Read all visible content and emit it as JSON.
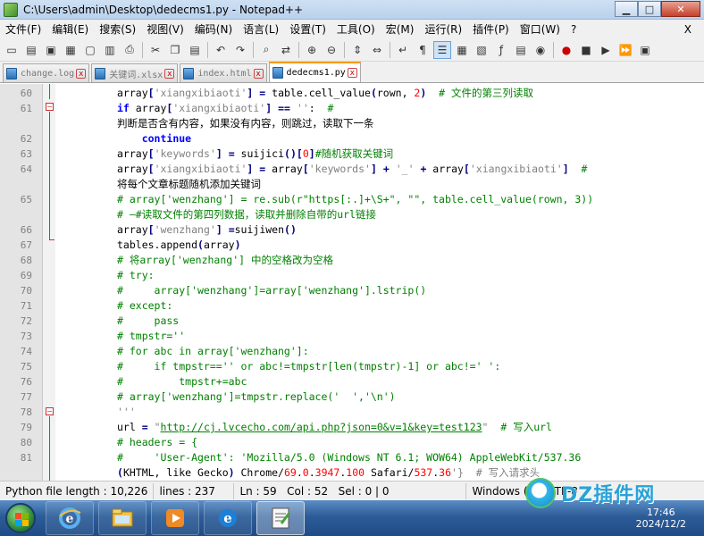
{
  "window": {
    "title": "C:\\Users\\admin\\Desktop\\dedecms1.py - Notepad++",
    "minimize_label": "▁",
    "maximize_label": "□",
    "close_label": "✕"
  },
  "menu": [
    "文件(F)",
    "编辑(E)",
    "搜索(S)",
    "视图(V)",
    "编码(N)",
    "语言(L)",
    "设置(T)",
    "工具(O)",
    "宏(M)",
    "运行(R)",
    "插件(P)",
    "窗口(W)",
    "?"
  ],
  "menu_close": "X",
  "tabs": [
    {
      "label": "change.log",
      "active": false
    },
    {
      "label": "关键词.xlsx",
      "active": false
    },
    {
      "label": "index.html",
      "active": false
    },
    {
      "label": "dedecms1.py",
      "active": true
    }
  ],
  "tab_close_glyph": "x",
  "editor": {
    "lines": [
      {
        "n": "60",
        "code": "array['xiangxibiaoti'] = table.cell_value(rown, 2)  # 文件的第三列读取"
      },
      {
        "n": "61",
        "code": "if array['xiangxibiaoti'] == '':  #"
      },
      {
        "n": "",
        "code": "判断是否含有内容，如果没有内容，则跳过，读取下一条"
      },
      {
        "n": "62",
        "code": "    continue"
      },
      {
        "n": "63",
        "code": "array['keywords'] = suijici()[0]#随机获取关键词"
      },
      {
        "n": "64",
        "code": "array['xiangxibiaoti'] = array['keywords'] + '_' + array['xiangxibiaoti']  #"
      },
      {
        "n": "",
        "code": "将每个文章标题随机添加关键词"
      },
      {
        "n": "65",
        "code": "# array['wenzhang'] = re.sub(r\"https[:.]+\\S+\", \"\", table.cell_value(rown, 3))"
      },
      {
        "n": "",
        "code": "# —#读取文件的第四列数据，读取并删除自带的url链接"
      },
      {
        "n": "66",
        "code": "array['wenzhang'] =suijiwen()"
      },
      {
        "n": "67",
        "code": "tables.append(array)"
      },
      {
        "n": "68",
        "code": "# 将array['wenzhang'] 中的空格改为空格"
      },
      {
        "n": "69",
        "code": "# try:"
      },
      {
        "n": "70",
        "code": "#     array['wenzhang']=array['wenzhang'].lstrip()"
      },
      {
        "n": "71",
        "code": "# except:"
      },
      {
        "n": "72",
        "code": "#     pass"
      },
      {
        "n": "73",
        "code": "# tmpstr=''"
      },
      {
        "n": "74",
        "code": "# for abc in array['wenzhang']:"
      },
      {
        "n": "75",
        "code": "#     if tmpstr=='' or abc!=tmpstr[len(tmpstr)-1] or abc!=' ':"
      },
      {
        "n": "76",
        "code": "#         tmpstr+=abc"
      },
      {
        "n": "77",
        "code": "# array['wenzhang']=tmpstr.replace('  ','\\n')"
      },
      {
        "n": "78",
        "code": "'''"
      },
      {
        "n": "79",
        "code": "url = \"http://cj.lvcecho.com/api.php?json=0&v=1&key=test123\"  # 写入url"
      },
      {
        "n": "80",
        "code": "# headers = {"
      },
      {
        "n": "81",
        "code": "#     'User-Agent': 'Mozilla/5.0 (Windows NT 6.1; WOW64) AppleWebKit/537.36"
      },
      {
        "n": "",
        "code": "(KHTML, like Gecko) Chrome/69.0.3947.100 Safari/537.36'}  # 写入请求头"
      }
    ]
  },
  "status": {
    "file_type": "Python file",
    "length": "length : 10,226",
    "lines": "lines : 237",
    "ln": "Ln : 59",
    "col": "Col : 52",
    "sel": "Sel : 0 | 0",
    "eol": "Windows (C",
    "encoding": "UTF-8"
  },
  "taskbar": {
    "time": "17:46",
    "date": "2024/12/2"
  },
  "watermark": "DZ插件网"
}
